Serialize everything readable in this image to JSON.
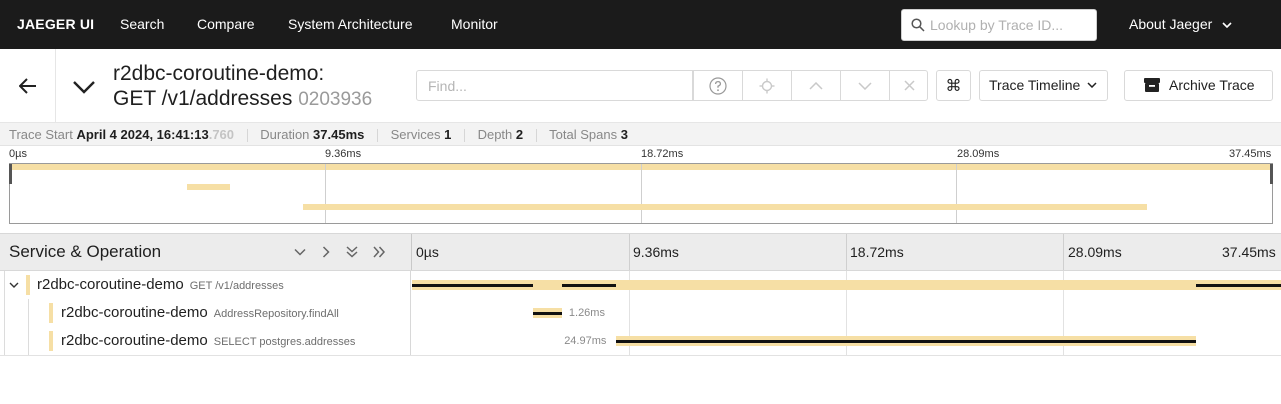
{
  "nav": {
    "brand": "JAEGER UI",
    "items": [
      "Search",
      "Compare",
      "System Architecture",
      "Monitor"
    ],
    "lookup_placeholder": "Lookup by Trace ID...",
    "about": "About Jaeger"
  },
  "trace": {
    "title_line1": "r2dbc-coroutine-demo:",
    "title_line2": "GET /v1/addresses",
    "trace_id_short": "0203936",
    "find_placeholder": "Find...",
    "view_mode": "Trace Timeline",
    "archive_label": "Archive Trace"
  },
  "summary": {
    "trace_start_label": "Trace Start",
    "trace_start_value": "April 4 2024, 16:41:13",
    "trace_start_ms": ".760",
    "duration_label": "Duration",
    "duration_value": "37.45ms",
    "services_label": "Services",
    "services_value": "1",
    "depth_label": "Depth",
    "depth_value": "2",
    "total_spans_label": "Total Spans",
    "total_spans_value": "3"
  },
  "minimap": {
    "ticks": [
      "0µs",
      "9.36ms",
      "18.72ms",
      "28.09ms",
      "37.45ms"
    ]
  },
  "timeline": {
    "header_title": "Service & Operation",
    "ticks": [
      "0µs",
      "9.36ms",
      "18.72ms",
      "28.09ms",
      "37.45ms"
    ],
    "total_ms": 37.45,
    "rows": [
      {
        "service": "r2dbc-coroutine-demo",
        "operation": "GET /v1/addresses",
        "depth": 0,
        "start_ms": 0,
        "duration_ms": 37.45,
        "duration_label": ""
      },
      {
        "service": "r2dbc-coroutine-demo",
        "operation": "AddressRepository.findAll",
        "depth": 1,
        "start_ms": 5.2,
        "duration_ms": 1.26,
        "duration_label": "1.26ms"
      },
      {
        "service": "r2dbc-coroutine-demo",
        "operation": "SELECT postgres.addresses",
        "depth": 1,
        "start_ms": 8.8,
        "duration_ms": 24.97,
        "duration_label": "24.97ms"
      }
    ]
  },
  "colors": {
    "span": "#f6dfa5",
    "nav_bg": "#1b1b1b"
  }
}
